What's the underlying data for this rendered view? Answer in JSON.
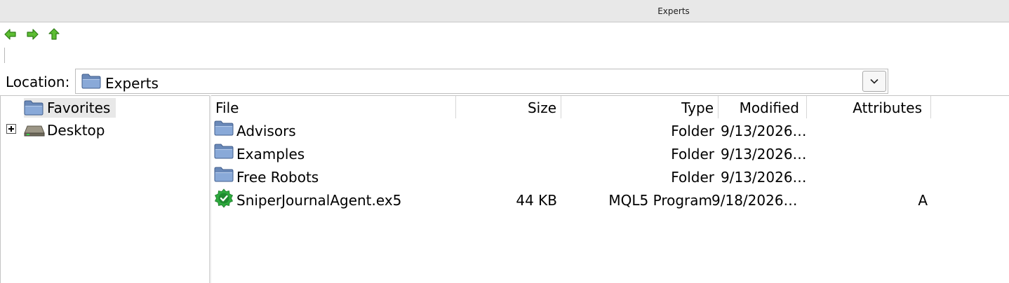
{
  "window": {
    "title": "Experts"
  },
  "location": {
    "label": "Location:",
    "value": "Experts"
  },
  "tree": {
    "items": [
      {
        "label": "Favorites",
        "icon": "folder-icon"
      },
      {
        "label": "Desktop",
        "icon": "drive-icon"
      }
    ]
  },
  "table": {
    "columns": [
      "File",
      "Size",
      "Type",
      "Modified",
      "Attributes"
    ],
    "rows": [
      {
        "name": "Advisors",
        "size": "",
        "type": "Folder",
        "modified": "9/13/2026…",
        "attributes": "",
        "icon": "folder-icon"
      },
      {
        "name": "Examples",
        "size": "",
        "type": "Folder",
        "modified": "9/13/2026…",
        "attributes": "",
        "icon": "folder-icon"
      },
      {
        "name": "Free Robots",
        "size": "",
        "type": "Folder",
        "modified": "9/13/2026…",
        "attributes": "",
        "icon": "folder-icon"
      },
      {
        "name": "SniperJournalAgent.ex5",
        "size": "44 KB",
        "type": "MQL5 Program",
        "modified": "9/18/2026…",
        "attributes": "A",
        "icon": "mql5-program-icon"
      }
    ]
  },
  "colors": {
    "nav_arrow": "#4caf2a",
    "folder": "#6b8fc4",
    "program_icon": "#2eaa3e"
  }
}
